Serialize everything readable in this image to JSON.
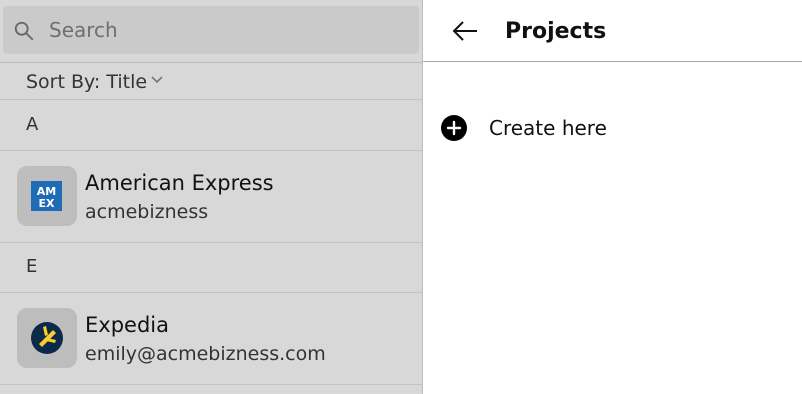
{
  "search": {
    "placeholder": "Search"
  },
  "sort": {
    "label": "Sort By: Title"
  },
  "sections": [
    {
      "letter": "A",
      "items": [
        {
          "title": "American Express",
          "subtitle": "acmebizness",
          "icon": "amex-logo-icon"
        }
      ]
    },
    {
      "letter": "E",
      "items": [
        {
          "title": "Expedia",
          "subtitle": "emily@acmebizness.com",
          "icon": "expedia-logo-icon"
        }
      ]
    }
  ],
  "header": {
    "title": "Projects"
  },
  "create": {
    "label": "Create here"
  },
  "colors": {
    "left_bg": "#d8d8d8",
    "search_bg": "#cacaca",
    "amex_blue": "#1f6bb6",
    "expedia_navy": "#0b2a4a",
    "expedia_yellow": "#fbce2d"
  }
}
